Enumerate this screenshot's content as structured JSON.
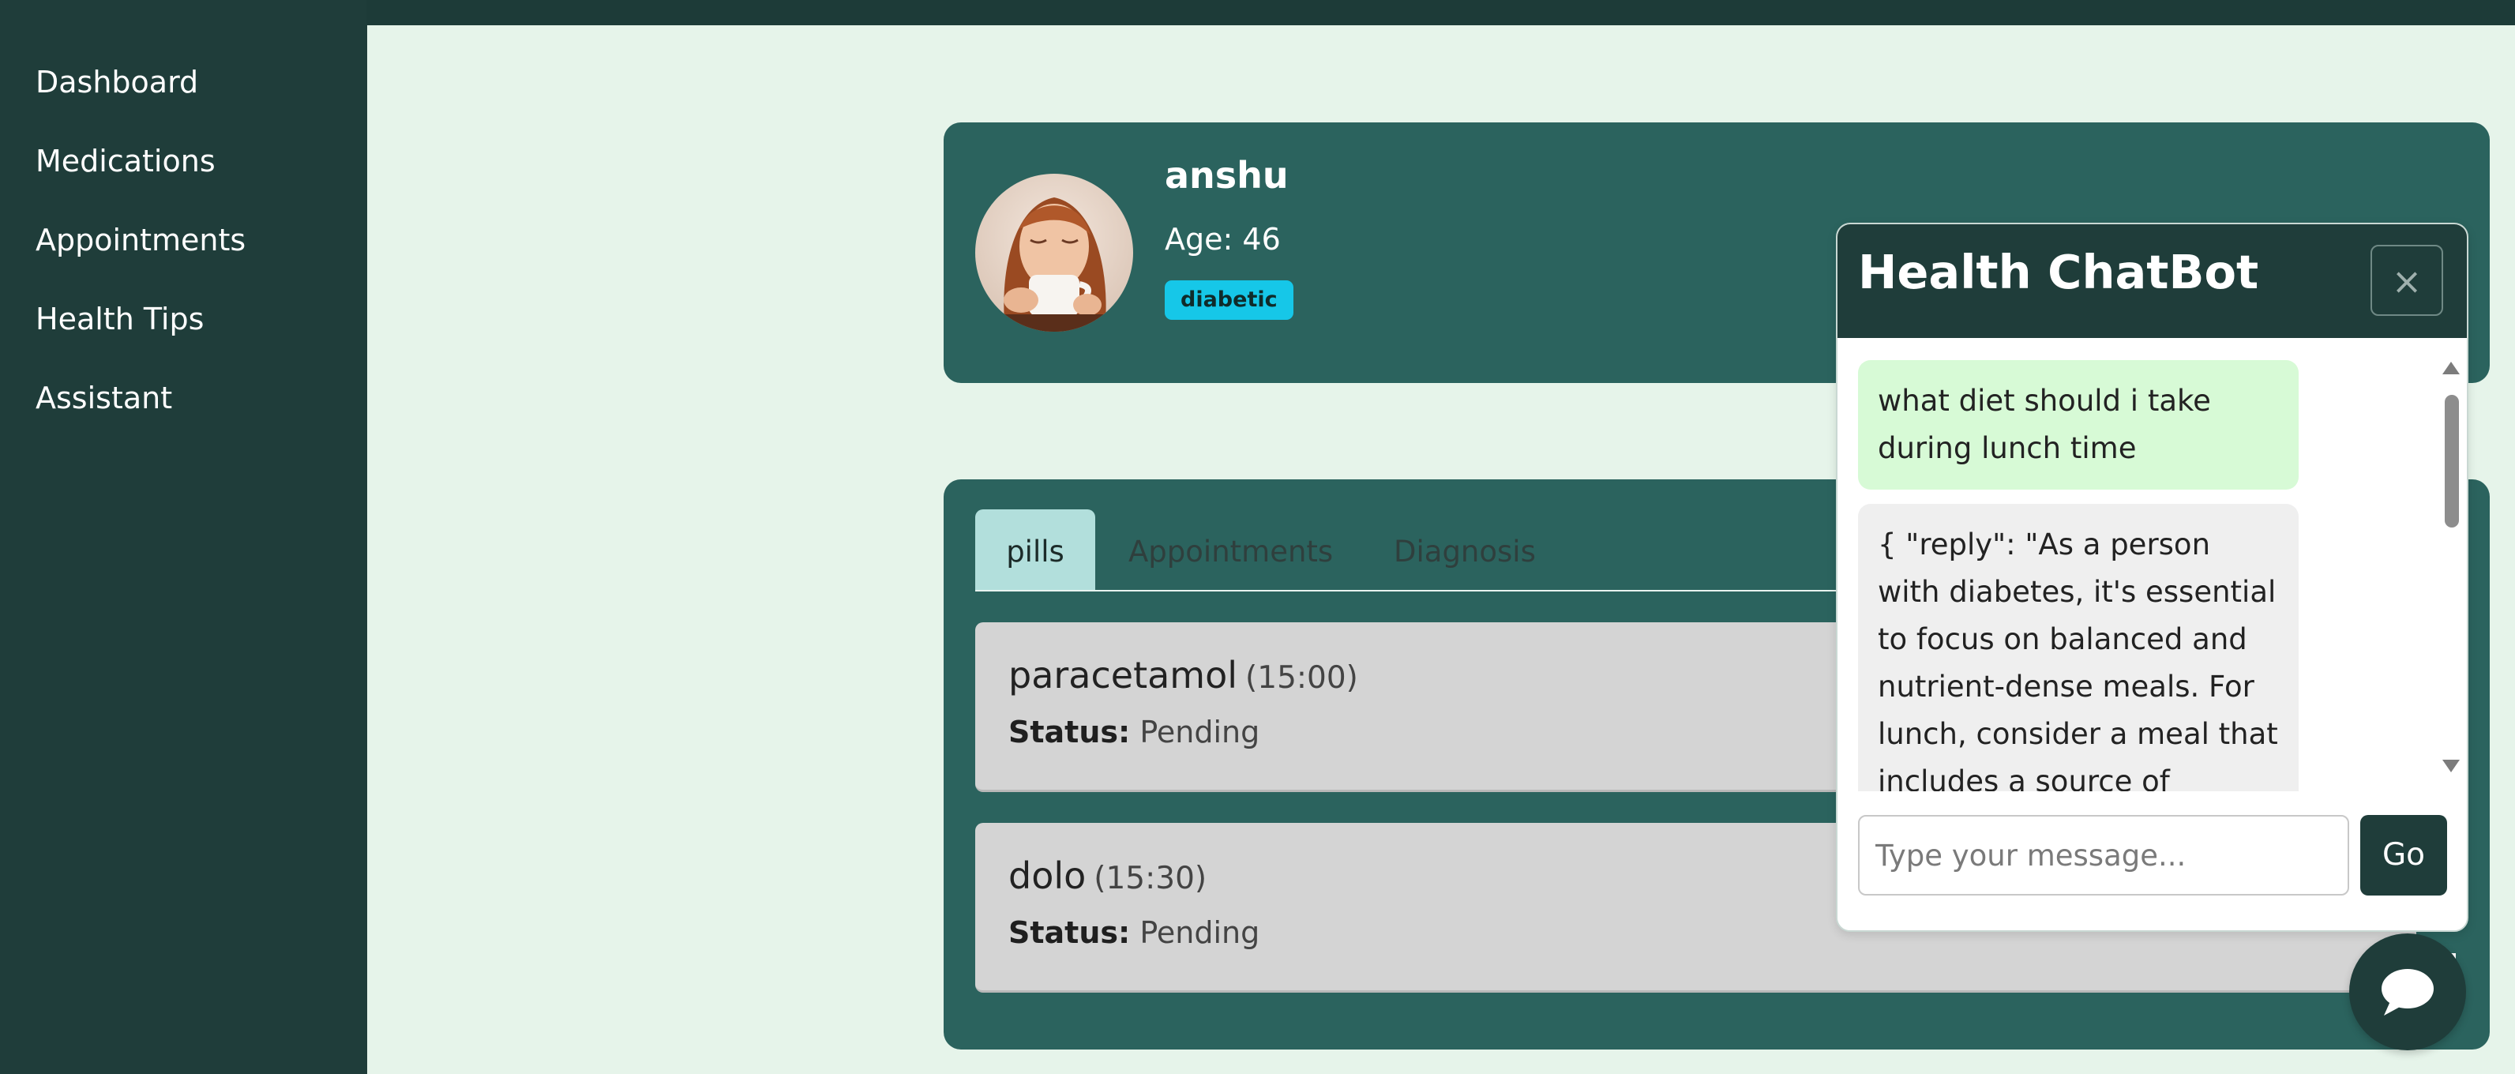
{
  "colors": {
    "sidebar_bg": "#1f3d3a",
    "main_bg": "#e6f4ea",
    "card_bg": "#2b635e",
    "badge_bg": "#16c7e8",
    "active_tab_bg": "#b2dfdc",
    "item_card_bg": "#d4d4d4",
    "user_msg_bg": "#d7fad6",
    "bot_msg_bg": "#efefef"
  },
  "sidebar": {
    "items": [
      {
        "label": "Dashboard"
      },
      {
        "label": "Medications"
      },
      {
        "label": "Appointments"
      },
      {
        "label": "Health Tips"
      },
      {
        "label": "Assistant"
      }
    ]
  },
  "profile": {
    "name": "anshu",
    "age_label": "Age:",
    "age_value": "46",
    "badge": "diabetic",
    "avatar_icon": "profile-photo"
  },
  "tabs": [
    {
      "label": "pills",
      "active": true
    },
    {
      "label": "Appointments",
      "active": false
    },
    {
      "label": "Diagnosis",
      "active": false
    }
  ],
  "pills": [
    {
      "name": "paracetamol",
      "time": "(15:00)",
      "status_label": "Status:",
      "status": "Pending"
    },
    {
      "name": "dolo",
      "time": "(15:30)",
      "status_label": "Status:",
      "status": "Pending"
    }
  ],
  "chatbot": {
    "title": "Health ChatBot",
    "close_label": "×",
    "close_icon": "close-icon",
    "messages": [
      {
        "role": "user",
        "text": "what diet should i take during lunch time"
      },
      {
        "role": "bot",
        "text": "{ \"reply\": \"As a person with diabetes, it's essential to focus on balanced and nutrient-dense meals. For lunch, consider a meal that includes a source of protein,"
      }
    ],
    "input": {
      "value": "",
      "placeholder": "Type your message..."
    },
    "send_label": "Go",
    "fab_icon": "chat-bubble-icon"
  }
}
